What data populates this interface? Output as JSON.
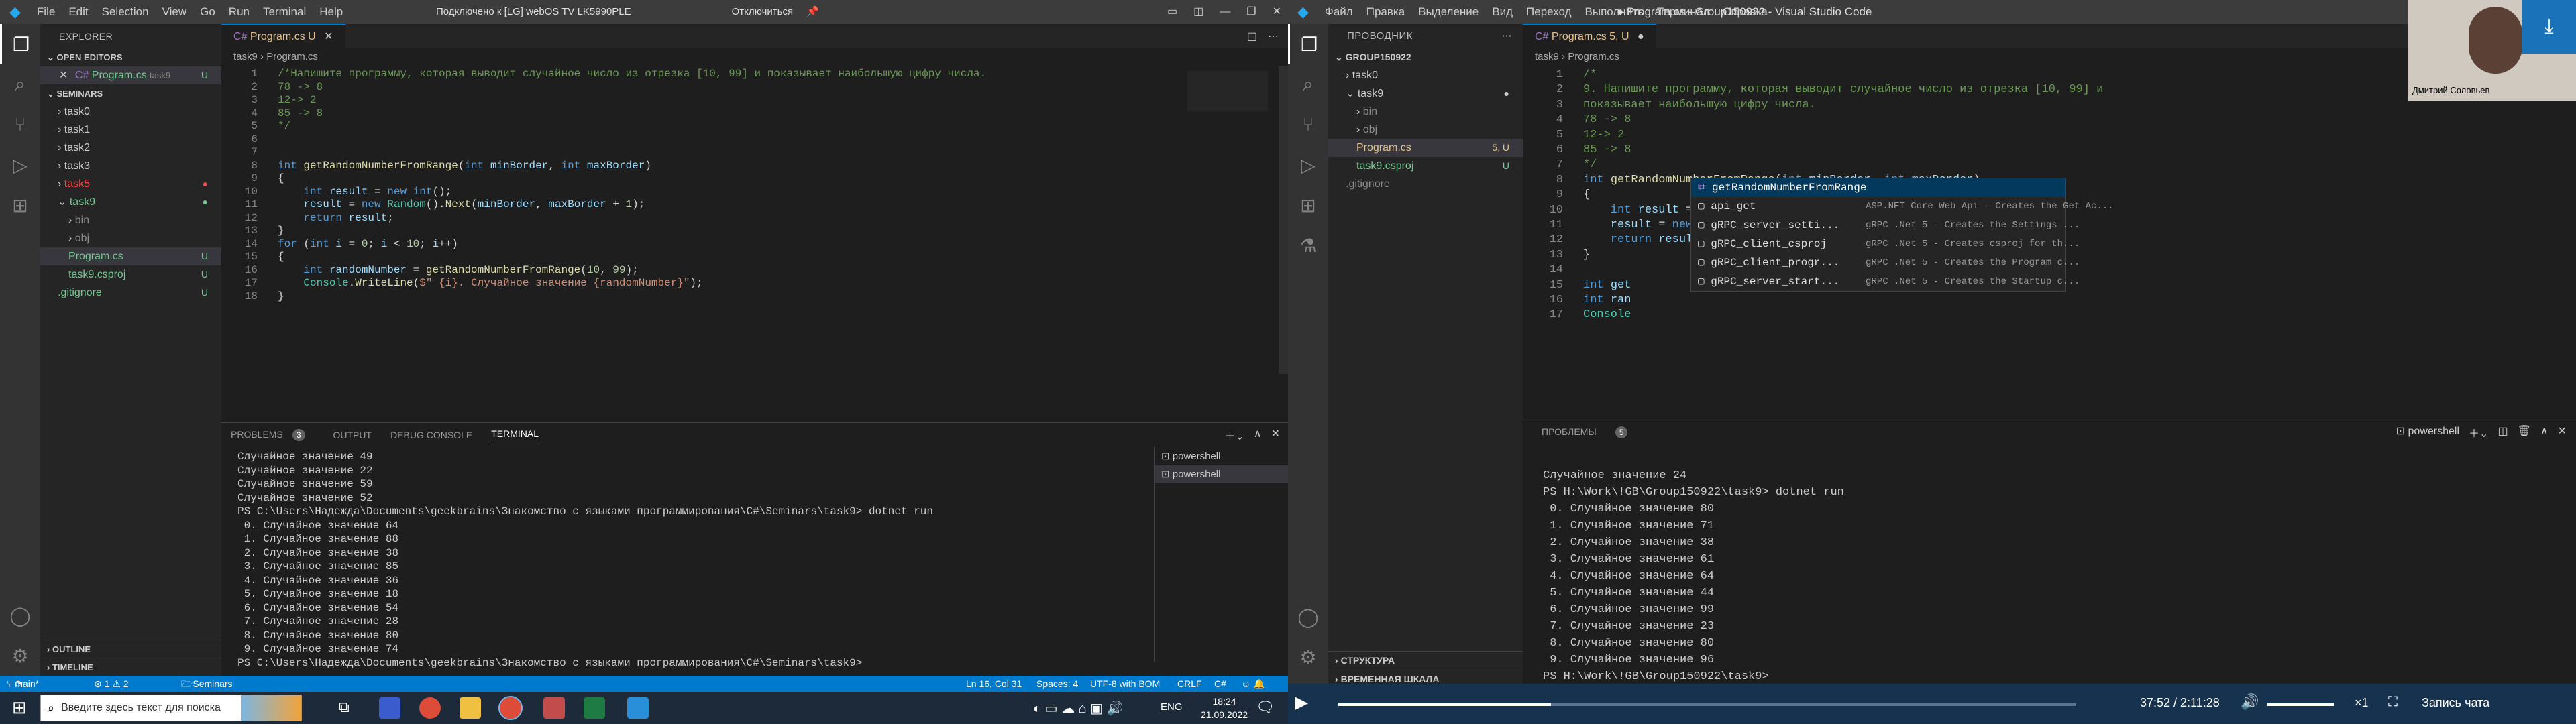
{
  "left": {
    "title_menu": [
      "File",
      "Edit",
      "Selection",
      "View",
      "Go",
      "Run",
      "Terminal",
      "Help"
    ],
    "remote_status": "Подключено к [LG] webOS TV LK5990PLE",
    "disconnect": "Отключиться",
    "explorer_header": "EXPLORER",
    "open_editors_header": "OPEN EDITORS",
    "open_editor_item": "Program.cs",
    "open_editor_folder": "task9",
    "open_editor_badge": "U",
    "folder_header": "SEMINARS",
    "tree": [
      {
        "label": "task0",
        "indent": 1,
        "arrow": "›",
        "color": "#ccc",
        "badge": ""
      },
      {
        "label": "task1",
        "indent": 1,
        "arrow": "›",
        "color": "#ccc",
        "badge": ""
      },
      {
        "label": "task2",
        "indent": 1,
        "arrow": "›",
        "color": "#ccc",
        "badge": ""
      },
      {
        "label": "task3",
        "indent": 1,
        "arrow": "›",
        "color": "#ccc",
        "badge": ""
      },
      {
        "label": "task5",
        "indent": 1,
        "arrow": "›",
        "color": "#f14c4c",
        "badge": "●"
      },
      {
        "label": "task9",
        "indent": 1,
        "arrow": "⌄",
        "color": "#73c991",
        "badge": "●"
      },
      {
        "label": "bin",
        "indent": 2,
        "arrow": "›",
        "color": "#8c8c8c",
        "badge": ""
      },
      {
        "label": "obj",
        "indent": 2,
        "arrow": "›",
        "color": "#8c8c8c",
        "badge": ""
      },
      {
        "label": "Program.cs",
        "indent": 2,
        "arrow": "",
        "color": "#73c991",
        "badge": "U"
      },
      {
        "label": "task9.csproj",
        "indent": 2,
        "arrow": "",
        "color": "#73c991",
        "badge": "U"
      },
      {
        "label": ".gitignore",
        "indent": 1,
        "arrow": "",
        "color": "#73c991",
        "badge": "U"
      }
    ],
    "outline": "OUTLINE",
    "timeline": "TIMELINE",
    "tab_label": "Program.cs",
    "tab_badge": "U",
    "breadcrumb": [
      "task9",
      "Program.cs"
    ],
    "code": [
      [
        {
          "t": "/*Напишите программу, которая выводит случайное число из отрезка [10, 99] и показывает наибольшую цифру числа.",
          "c": "com"
        }
      ],
      [
        {
          "t": "78 -> 8",
          "c": "com"
        }
      ],
      [
        {
          "t": "12-> 2",
          "c": "com"
        }
      ],
      [
        {
          "t": "85 -> 8",
          "c": "com"
        }
      ],
      [
        {
          "t": "*/",
          "c": "com"
        }
      ],
      [],
      [],
      [
        {
          "t": "int ",
          "c": "kw"
        },
        {
          "t": "getRandomNumberFromRange",
          "c": "fn"
        },
        {
          "t": "(",
          "c": "txt"
        },
        {
          "t": "int ",
          "c": "kw"
        },
        {
          "t": "minBorder",
          "c": "var"
        },
        {
          "t": ", ",
          "c": "txt"
        },
        {
          "t": "int ",
          "c": "kw"
        },
        {
          "t": "maxBorder",
          "c": "var"
        },
        {
          "t": ")",
          "c": "txt"
        }
      ],
      [
        {
          "t": "{",
          "c": "txt"
        }
      ],
      [
        {
          "t": "    int ",
          "c": "kw"
        },
        {
          "t": "result",
          "c": "var"
        },
        {
          "t": " = ",
          "c": "txt"
        },
        {
          "t": "new ",
          "c": "kw"
        },
        {
          "t": "int",
          "c": "kw"
        },
        {
          "t": "();",
          "c": "txt"
        }
      ],
      [
        {
          "t": "    result",
          "c": "var"
        },
        {
          "t": " = ",
          "c": "txt"
        },
        {
          "t": "new ",
          "c": "kw"
        },
        {
          "t": "Random",
          "c": "ty"
        },
        {
          "t": "().",
          "c": "txt"
        },
        {
          "t": "Next",
          "c": "fn"
        },
        {
          "t": "(",
          "c": "txt"
        },
        {
          "t": "minBorder",
          "c": "var"
        },
        {
          "t": ", ",
          "c": "txt"
        },
        {
          "t": "maxBorder",
          "c": "var"
        },
        {
          "t": " + ",
          "c": "txt"
        },
        {
          "t": "1",
          "c": "num"
        },
        {
          "t": ");",
          "c": "txt"
        }
      ],
      [
        {
          "t": "    return ",
          "c": "kw"
        },
        {
          "t": "result",
          "c": "var"
        },
        {
          "t": ";",
          "c": "txt"
        }
      ],
      [
        {
          "t": "}",
          "c": "txt"
        }
      ],
      [
        {
          "t": "for ",
          "c": "kw"
        },
        {
          "t": "(",
          "c": "txt"
        },
        {
          "t": "int ",
          "c": "kw"
        },
        {
          "t": "i",
          "c": "var"
        },
        {
          "t": " = ",
          "c": "txt"
        },
        {
          "t": "0",
          "c": "num"
        },
        {
          "t": "; ",
          "c": "txt"
        },
        {
          "t": "i",
          "c": "var"
        },
        {
          "t": " < ",
          "c": "txt"
        },
        {
          "t": "10",
          "c": "num"
        },
        {
          "t": "; ",
          "c": "txt"
        },
        {
          "t": "i",
          "c": "var"
        },
        {
          "t": "++)",
          "c": "txt"
        }
      ],
      [
        {
          "t": "{",
          "c": "txt"
        }
      ],
      [
        {
          "t": "    int ",
          "c": "kw"
        },
        {
          "t": "randomNumber",
          "c": "var"
        },
        {
          "t": " = ",
          "c": "txt"
        },
        {
          "t": "getRandomNumberFromRange",
          "c": "fn"
        },
        {
          "t": "(",
          "c": "txt"
        },
        {
          "t": "10",
          "c": "num"
        },
        {
          "t": ", ",
          "c": "txt"
        },
        {
          "t": "99",
          "c": "num"
        },
        {
          "t": ");",
          "c": "txt"
        }
      ],
      [
        {
          "t": "    Console",
          "c": "ty"
        },
        {
          "t": ".",
          "c": "txt"
        },
        {
          "t": "WriteLine",
          "c": "fn"
        },
        {
          "t": "(",
          "c": "txt"
        },
        {
          "t": "$\" {i}. Случайное значение {randomNumber}\"",
          "c": "str"
        },
        {
          "t": ");",
          "c": "txt"
        }
      ],
      [
        {
          "t": "}",
          "c": "txt"
        }
      ]
    ],
    "panel_tabs": [
      "PROBLEMS",
      "OUTPUT",
      "DEBUG CONSOLE",
      "TERMINAL"
    ],
    "problems_count": "3",
    "terminal_lines": [
      "Случайное значение 49",
      "Случайное значение 22",
      "Случайное значение 59",
      "Случайное значение 52",
      "PS C:\\Users\\Надежда\\Documents\\geekbrains\\Знакомство с языками программирования\\C#\\Seminars\\task9> dotnet run",
      " 0. Случайное значение 64",
      " 1. Случайное значение 88",
      " 2. Случайное значение 38",
      " 3. Случайное значение 85",
      " 4. Случайное значение 36",
      " 5. Случайное значение 18",
      " 6. Случайное значение 54",
      " 7. Случайное значение 28",
      " 8. Случайное значение 80",
      " 9. Случайное значение 74",
      "PS C:\\Users\\Надежда\\Documents\\geekbrains\\Знакомство с языками программирования\\C#\\Seminars\\task9> "
    ],
    "shells": [
      "powershell",
      "powershell"
    ],
    "status_left": [
      "main*",
      "⊗ 1 ⚠ 2",
      "Seminars"
    ],
    "status_right": [
      "Ln 16, Col 31",
      "Spaces: 4",
      "UTF-8 with BOM",
      "CRLF",
      "C#"
    ]
  },
  "right": {
    "title_menu": [
      "Файл",
      "Правка",
      "Выделение",
      "Вид",
      "Переход",
      "Выполнить",
      "Терминал",
      "Справка"
    ],
    "window_title": "● Program.cs - Group150922 - Visual Studio Code",
    "explorer_header": "ПРОВОДНИК",
    "folder_header": "GROUP150922",
    "tree": [
      {
        "label": "task0",
        "indent": 1,
        "arrow": "›",
        "color": "#ccc",
        "badge": ""
      },
      {
        "label": "task9",
        "indent": 1,
        "arrow": "⌄",
        "color": "#ccc",
        "badge": "●"
      },
      {
        "label": "bin",
        "indent": 2,
        "arrow": "›",
        "color": "#8c8c8c",
        "badge": ""
      },
      {
        "label": "obj",
        "indent": 2,
        "arrow": "›",
        "color": "#8c8c8c",
        "badge": ""
      },
      {
        "label": "Program.cs",
        "indent": 2,
        "arrow": "",
        "color": "#e2c08d",
        "badge": "5, U"
      },
      {
        "label": "task9.csproj",
        "indent": 2,
        "arrow": "",
        "color": "#73c991",
        "badge": "U"
      },
      {
        "label": ".gitignore",
        "indent": 1,
        "arrow": "",
        "color": "#8c8c8c",
        "badge": ""
      }
    ],
    "structure": "СТРУКТУРА",
    "timeline": "ВРЕМЕННАЯ ШКАЛА",
    "tab_label": "Program.cs",
    "tab_badge": "5, U",
    "breadcrumb": [
      "task9",
      "Program.cs"
    ],
    "code": [
      [
        {
          "t": "/*",
          "c": "com"
        }
      ],
      [
        {
          "t": "9. Напишите программу, которая выводит случайное число из отрезка [10, 99] и",
          "c": "com"
        }
      ],
      [
        {
          "t": "показывает наибольшую цифру числа.",
          "c": "com"
        }
      ],
      [
        {
          "t": "78 -> 8",
          "c": "com"
        }
      ],
      [
        {
          "t": "12-> 2",
          "c": "com"
        }
      ],
      [
        {
          "t": "85 -> 8",
          "c": "com"
        }
      ],
      [
        {
          "t": "*/",
          "c": "com"
        }
      ],
      [
        {
          "t": "int ",
          "c": "kw"
        },
        {
          "t": "getRandomNumberFromRange",
          "c": "fn"
        },
        {
          "t": "(",
          "c": "txt"
        },
        {
          "t": "int ",
          "c": "kw"
        },
        {
          "t": "minBorder",
          "c": "var"
        },
        {
          "t": ", ",
          "c": "txt"
        },
        {
          "t": "int ",
          "c": "kw"
        },
        {
          "t": "maxBorder",
          "c": "var"
        },
        {
          "t": ")",
          "c": "txt"
        }
      ],
      [
        {
          "t": "{",
          "c": "txt"
        }
      ],
      [
        {
          "t": "    int ",
          "c": "kw"
        },
        {
          "t": "result",
          "c": "var"
        },
        {
          "t": " = ",
          "c": "txt"
        },
        {
          "t": "new ",
          "c": "kw"
        },
        {
          "t": "int",
          "c": "kw"
        },
        {
          "t": "();",
          "c": "txt"
        }
      ],
      [
        {
          "t": "    result",
          "c": "var"
        },
        {
          "t": " = ",
          "c": "txt"
        },
        {
          "t": "new ",
          "c": "kw"
        },
        {
          "t": "Random",
          "c": "ty"
        },
        {
          "t": "().",
          "c": "txt"
        },
        {
          "t": "Next",
          "c": "fn"
        },
        {
          "t": "(",
          "c": "txt"
        },
        {
          "t": "minBorder",
          "c": "var"
        },
        {
          "t": ",",
          "c": "txt"
        },
        {
          "t": "maxBorder",
          "c": "var"
        },
        {
          "t": " + ",
          "c": "txt"
        },
        {
          "t": "1",
          "c": "num"
        },
        {
          "t": ");",
          "c": "txt"
        }
      ],
      [
        {
          "t": "    return ",
          "c": "kw"
        },
        {
          "t": "result",
          "c": "var"
        },
        {
          "t": ";",
          "c": "txt"
        }
      ],
      [
        {
          "t": "}",
          "c": "txt"
        }
      ],
      [],
      [
        {
          "t": "int ",
          "c": "kw"
        },
        {
          "t": "get",
          "c": "var"
        }
      ],
      [
        {
          "t": "int ",
          "c": "kw"
        },
        {
          "t": "ran",
          "c": "var"
        }
      ],
      [
        {
          "t": "Console",
          "c": "ty"
        }
      ]
    ],
    "autocomplete": [
      {
        "label": "getRandomNumberFromRange",
        "desc": ""
      },
      {
        "label": "api_get",
        "desc": "ASP.NET Core Web Api - Creates the Get Ac..."
      },
      {
        "label": "gRPC_server_setti...",
        "desc": "gRPC .Net 5 - Creates the Settings ..."
      },
      {
        "label": "gRPC_client_csproj",
        "desc": "gRPC .Net 5 - Creates csproj for th..."
      },
      {
        "label": "gRPC_client_progr...",
        "desc": "gRPC .Net 5 - Creates the Program c..."
      },
      {
        "label": "gRPC_server_start...",
        "desc": "gRPC .Net 5 - Creates the Startup c..."
      }
    ],
    "panel_tab": "ПРОБЛЕМЫ",
    "problems_count": "5",
    "shell": "powershell",
    "terminal_lines": [
      "Случайное значение 24",
      "PS H:\\Work\\!GB\\Group150922\\task9> dotnet run",
      " 0. Случайное значение 80",
      " 1. Случайное значение 71",
      " 2. Случайное значение 38",
      " 3. Случайное значение 61",
      " 4. Случайное значение 64",
      " 5. Случайное значение 44",
      " 6. Случайное значение 99",
      " 7. Случайное значение 23",
      " 8. Случайное значение 80",
      " 9. Случайное значение 96",
      "PS H:\\Work\\!GB\\Group150922\\task9> "
    ],
    "webcam_name": "Дмитрий Соловьев"
  },
  "taskbar": {
    "search_placeholder": "Введите здесь текст для поиска",
    "lang": "ENG",
    "time": "18:24",
    "date": "21.09.2022"
  },
  "player": {
    "time": "37:52 / 2:11:28",
    "speed": "×1",
    "record_label": "Запись чата",
    "progress": 0.288
  }
}
